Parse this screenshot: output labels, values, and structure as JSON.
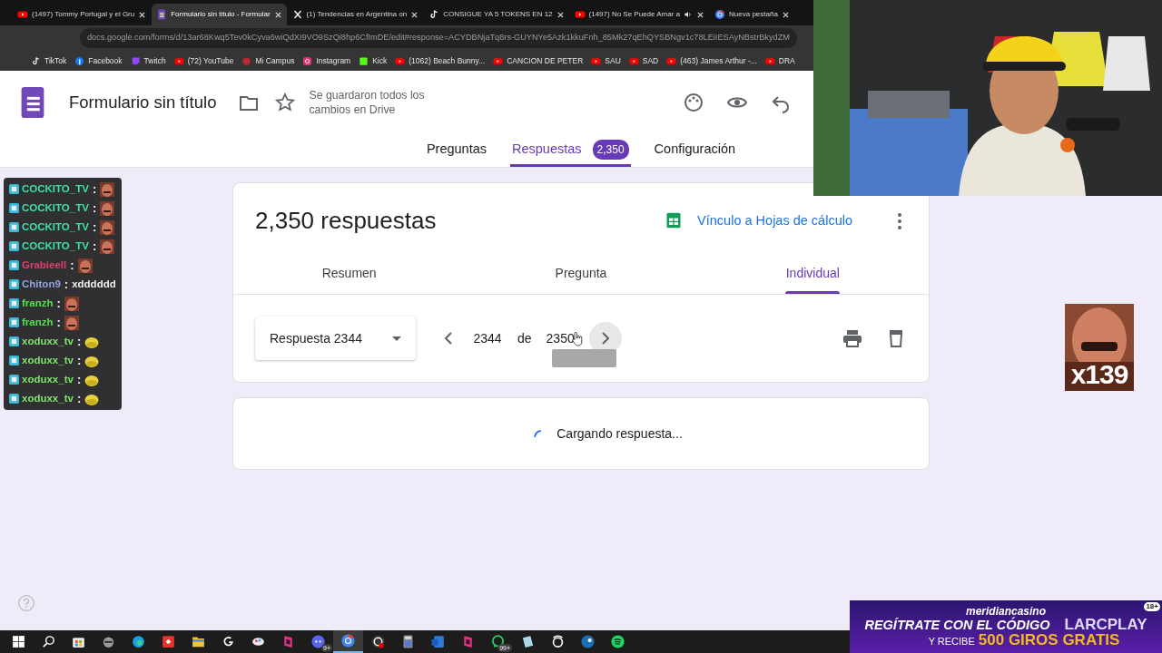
{
  "browser": {
    "tabs": [
      {
        "title": "(1497) Tommy Portugal y el Gru",
        "kind": "youtube",
        "selected": false,
        "audio": false
      },
      {
        "title": "Formulario sin título - Formular",
        "kind": "forms",
        "selected": true,
        "audio": false
      },
      {
        "title": "(1) Tendencias en Argentina on",
        "kind": "x",
        "selected": false,
        "audio": false
      },
      {
        "title": "CONSIGUE YA 5 TOKENS EN 12",
        "kind": "tiktok",
        "selected": false,
        "audio": false
      },
      {
        "title": "(1497) No Se Puede Amar a",
        "kind": "youtube",
        "selected": false,
        "audio": true
      },
      {
        "title": "Nueva pestaña",
        "kind": "chrome",
        "selected": false,
        "audio": false
      }
    ],
    "address": "docs.google.com/forms/d/13ar68Kwq5Tev0kCyva6wiQdXI9VO9SzQi8hp6CfImDE/edit#response=ACYDBNjaTq8rs-GUYNYe5Azk1kkuFnh_85Mk27qEhQYSBNgv1c78LEiIESAyNBstrBkydZM",
    "bookmarks": [
      {
        "label": "TikTok",
        "kind": "tiktok"
      },
      {
        "label": "Facebook",
        "kind": "facebook"
      },
      {
        "label": "Twitch",
        "kind": "twitch"
      },
      {
        "label": "(72) YouTube",
        "kind": "youtube"
      },
      {
        "label": "Mi Campus",
        "kind": "campus"
      },
      {
        "label": "Instagram",
        "kind": "instagram"
      },
      {
        "label": "Kick",
        "kind": "kick"
      },
      {
        "label": "(1062) Beach Bunny...",
        "kind": "youtube"
      },
      {
        "label": "CANCION DE PETER",
        "kind": "youtube"
      },
      {
        "label": "SAU",
        "kind": "youtube"
      },
      {
        "label": "SAD",
        "kind": "youtube"
      },
      {
        "label": "(463) James Arthur -...",
        "kind": "youtube"
      },
      {
        "label": "DRA",
        "kind": "youtube"
      }
    ]
  },
  "form": {
    "title": "Formulario sin título",
    "save_status": "Se guardaron todos los cambios en Drive",
    "tabs": [
      {
        "label": "Preguntas",
        "selected": false
      },
      {
        "label": "Respuestas",
        "selected": true,
        "badge": "2,350"
      },
      {
        "label": "Configuración",
        "selected": false
      }
    ]
  },
  "responses": {
    "count": "2,350 respuestas",
    "sheets_link": "Vínculo a Hojas de cálculo",
    "views": [
      {
        "label": "Resumen",
        "selected": false
      },
      {
        "label": "Pregunta",
        "selected": false
      },
      {
        "label": "Individual",
        "selected": true
      }
    ],
    "response_select": "Respuesta 2344",
    "page_input": "2344",
    "page_of": "de",
    "page_total": "2350",
    "next_hovered": true,
    "tooltip_shown": true
  },
  "loading": {
    "text": "Cargando respuesta..."
  },
  "chat": [
    {
      "user": "COCKITO_TV",
      "separator": ":",
      "color": "#3ee0a6",
      "kind": "emote"
    },
    {
      "user": "COCKITO_TV",
      "separator": ":",
      "color": "#3ee0a6",
      "kind": "emote"
    },
    {
      "user": "COCKITO_TV",
      "separator": ":",
      "color": "#3ee0a6",
      "kind": "emote"
    },
    {
      "user": "COCKITO_TV",
      "separator": ":",
      "color": "#3ee0a6",
      "kind": "emote"
    },
    {
      "user": "Grabieell",
      "separator": ":",
      "color": "#e0406e",
      "kind": "emote"
    },
    {
      "user": "Chiton9",
      "separator": ":",
      "color": "#8ea4e4",
      "kind": "text",
      "message": "xdddddd"
    },
    {
      "user": "franzh",
      "separator": ":",
      "color": "#52e04e",
      "kind": "emote"
    },
    {
      "user": "franzh",
      "separator": ":",
      "color": "#52e04e",
      "kind": "emote"
    },
    {
      "user": "xoduxx_tv",
      "separator": ":",
      "color": "#7fe46c",
      "kind": "emote"
    },
    {
      "user": "xoduxx_tv",
      "separator": ":",
      "color": "#7fe46c",
      "kind": "emote"
    },
    {
      "user": "xoduxx_tv",
      "separator": ":",
      "color": "#7fe46c",
      "kind": "emote"
    },
    {
      "user": "xoduxx_tv",
      "separator": ":",
      "color": "#7fe46c",
      "kind": "emote"
    }
  ],
  "emote_counter": {
    "text": "x139"
  },
  "ad": {
    "brand": "meridiancasino",
    "line_1": "REGÍTRATE CON EL CÓDIGO",
    "code": "LARCPLAY",
    "line_2": "Y RECIBE",
    "offer": "500 GIROS GRATIS",
    "age": "18+"
  },
  "taskbar": {
    "apps": [
      {
        "kind": "windows",
        "selected": false
      },
      {
        "kind": "search",
        "selected": false
      },
      {
        "kind": "store",
        "selected": false
      },
      {
        "kind": "cat",
        "selected": false
      },
      {
        "kind": "edge",
        "selected": false
      },
      {
        "kind": "redapp",
        "selected": false
      },
      {
        "kind": "folder",
        "selected": false
      },
      {
        "kind": "logi",
        "selected": false
      },
      {
        "kind": "paint",
        "selected": false
      },
      {
        "kind": "pinkapp",
        "selected": false
      },
      {
        "kind": "discord",
        "selected": false,
        "badge": "9+"
      },
      {
        "kind": "chrome",
        "selected": true
      },
      {
        "kind": "obs",
        "selected": false
      },
      {
        "kind": "calc",
        "selected": false
      },
      {
        "kind": "word",
        "selected": false
      },
      {
        "kind": "pinkapp",
        "selected": false
      },
      {
        "kind": "whatsapp",
        "selected": false,
        "badge": "99+"
      },
      {
        "kind": "notes",
        "selected": false
      },
      {
        "kind": "ring",
        "selected": false
      },
      {
        "kind": "steam",
        "selected": false
      },
      {
        "kind": "spotify",
        "selected": false
      }
    ]
  }
}
